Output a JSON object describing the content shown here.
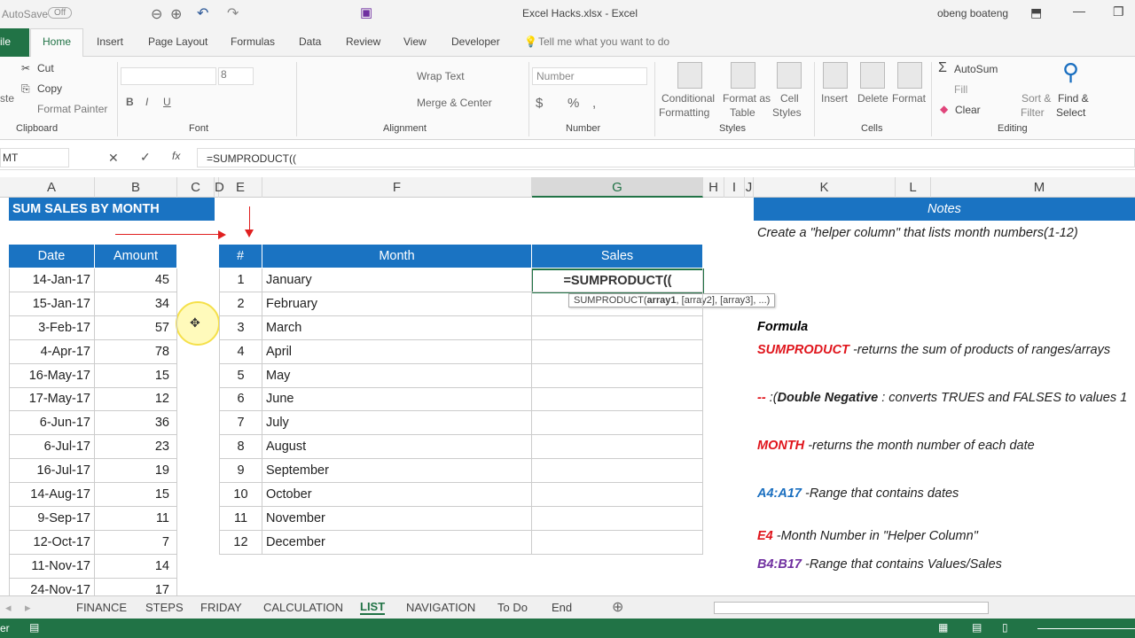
{
  "window": {
    "autosave_label": "AutoSave",
    "autosave_state": "Off",
    "title": "Excel Hacks.xlsx  -  Excel",
    "user": "obeng boateng"
  },
  "ribbon_tabs": [
    "ile",
    "Home",
    "Insert",
    "Page Layout",
    "Formulas",
    "Data",
    "Review",
    "View",
    "Developer"
  ],
  "tell_me": "Tell me what you want to do",
  "clipboard": {
    "paste": "ste",
    "cut": "Cut",
    "copy": "Copy",
    "format_painter": "Format Painter",
    "group": "Clipboard"
  },
  "font": {
    "size": "8",
    "bold": "B",
    "italic": "I",
    "underline": "U",
    "group": "Font"
  },
  "alignment": {
    "wrap": "Wrap Text",
    "merge": "Merge & Center",
    "group": "Alignment"
  },
  "number": {
    "format": "Number",
    "currency": "$",
    "percent": "%",
    "comma": ",",
    "group": "Number"
  },
  "styles": {
    "conditional": [
      "Conditional",
      "Formatting"
    ],
    "format_table": [
      "Format as",
      "Table"
    ],
    "cell_styles": [
      "Cell",
      "Styles"
    ],
    "group": "Styles"
  },
  "cells": {
    "insert": "Insert",
    "delete": "Delete",
    "format": "Format",
    "group": "Cells"
  },
  "editing": {
    "autosum": "AutoSum",
    "fill": "Fill",
    "clear": "Clear",
    "sort": [
      "Sort &",
      "Filter"
    ],
    "find": [
      "Find &",
      "Select"
    ],
    "group": "Editing"
  },
  "formula_bar": {
    "name_box": "MT",
    "formula": "=SUMPRODUCT(("
  },
  "columns": [
    "A",
    "B",
    "C",
    "D",
    "E",
    "F",
    "G",
    "H",
    "I",
    "J",
    "K",
    "L",
    "M"
  ],
  "left_table": {
    "title": "SUM SALES BY MONTH",
    "headers": [
      "Date",
      "Amount"
    ],
    "rows": [
      [
        "14-Jan-17",
        "45"
      ],
      [
        "15-Jan-17",
        "34"
      ],
      [
        "3-Feb-17",
        "57"
      ],
      [
        "4-Apr-17",
        "78"
      ],
      [
        "16-May-17",
        "15"
      ],
      [
        "17-May-17",
        "12"
      ],
      [
        "6-Jun-17",
        "36"
      ],
      [
        "6-Jul-17",
        "23"
      ],
      [
        "16-Jul-17",
        "19"
      ],
      [
        "14-Aug-17",
        "15"
      ],
      [
        "9-Sep-17",
        "11"
      ],
      [
        "12-Oct-17",
        "7"
      ],
      [
        "11-Nov-17",
        "14"
      ],
      [
        "24-Nov-17",
        "17"
      ]
    ]
  },
  "month_table": {
    "headers": [
      "#",
      "Month",
      "Sales"
    ],
    "rows": [
      [
        "1",
        "January"
      ],
      [
        "2",
        "February"
      ],
      [
        "3",
        "March"
      ],
      [
        "4",
        "April"
      ],
      [
        "5",
        "May"
      ],
      [
        "6",
        "June"
      ],
      [
        "7",
        "July"
      ],
      [
        "8",
        "August"
      ],
      [
        "9",
        "September"
      ],
      [
        "10",
        "October"
      ],
      [
        "11",
        "November"
      ],
      [
        "12",
        "December"
      ]
    ],
    "active_cell": "=SUMPRODUCT((",
    "tooltip_fn": "SUMPRODUCT(",
    "tooltip_arg1": "array1",
    "tooltip_rest": ", [array2], [array3], ...)"
  },
  "notes": {
    "header": "Notes",
    "helper": "Create a \"helper column\" that lists month numbers(1-12)",
    "formula_label": "Formula",
    "items": [
      {
        "key": "SUMPRODUCT",
        "text": " -returns the sum of products of ranges/arrays",
        "color": "#e0151c"
      },
      {
        "key": "--",
        "extra": " :(",
        "bold": "Double Negative",
        "text": " : converts TRUES and FALSES to values 1",
        "color": "#e0151c"
      },
      {
        "key": "MONTH",
        "text": " -returns the month number of each date",
        "color": "#e0151c"
      },
      {
        "key": "A4:A17",
        "text": " -Range that contains dates",
        "color": "#1a6fc0"
      },
      {
        "key": "E4",
        "text": " -Month Number in \"Helper Column\"",
        "color": "#e0151c"
      },
      {
        "key": "B4:B17",
        "text": " -Range that contains Values/Sales",
        "color": "#7030a0"
      }
    ]
  },
  "sheet_tabs": [
    "FINANCE",
    "STEPS",
    "FRIDAY",
    "CALCULATION",
    "LIST",
    "NAVIGATION",
    "To Do",
    "End"
  ],
  "active_sheet": "LIST",
  "status": {
    "mode": "er"
  },
  "colors": {
    "header_blue": "#1a73c2",
    "excel_green": "#217346"
  }
}
